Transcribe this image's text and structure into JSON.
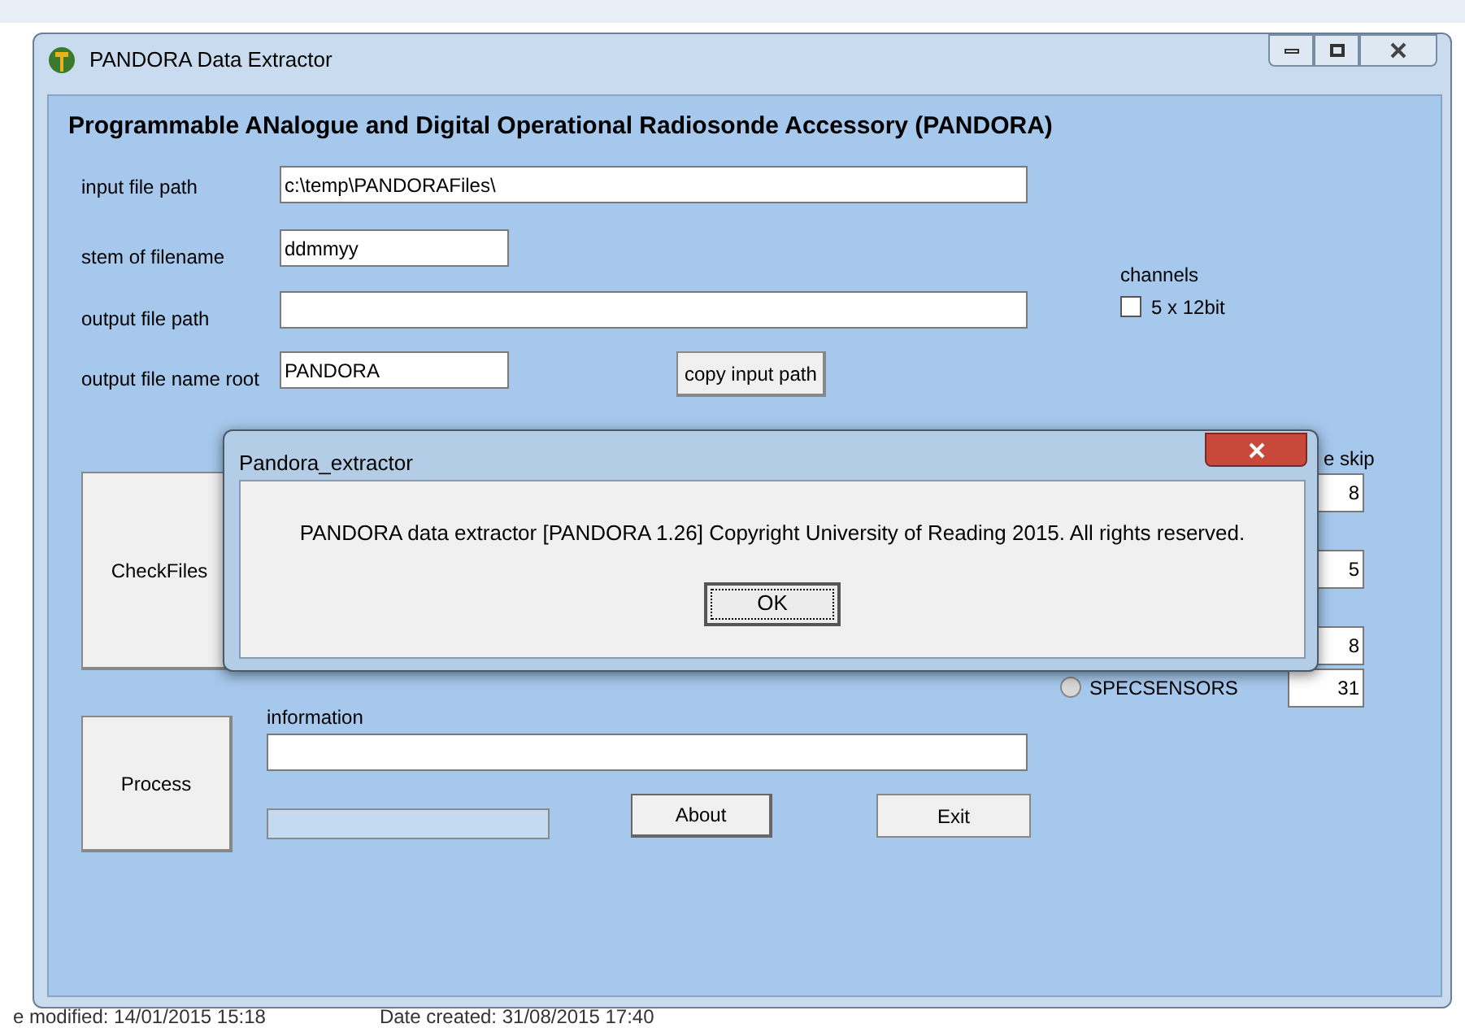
{
  "window": {
    "title": "PANDORA Data Extractor"
  },
  "header": "Programmable ANalogue and Digital Operational Radiosonde Accessory (PANDORA)",
  "fields": [
    {
      "label": "input file path",
      "value": "c:\\temp\\PANDORAFiles\\",
      "wide": true
    },
    {
      "label": "stem of filename",
      "value": "ddmmyy",
      "wide": false
    },
    {
      "label": "output file path",
      "wide": true
    },
    {
      "label": "output file name root",
      "value": "PANDORA",
      "wide": false
    }
  ],
  "copy_button": "copy input path",
  "channels": {
    "label": "channels",
    "option": {
      "label": "5 x 12bit",
      "checked": false
    }
  },
  "skip": {
    "label": "e skip",
    "values": [
      "8",
      "5",
      "8",
      "31"
    ]
  },
  "sensor_option": {
    "label": "SPECSENSORS",
    "selected": false
  },
  "checkfiles_button": "CheckFiles",
  "process_button": "Process",
  "information": {
    "label": "information"
  },
  "progress": {
    "level": 0
  },
  "about_button": "About",
  "exit_button": "Exit",
  "dialog": {
    "title": "Pandora_extractor",
    "message": "PANDORA data extractor [PANDORA 1.26] Copyright University of Reading 2015. All rights reserved.",
    "button": "OK"
  },
  "status_bar": [
    "e modified: 14/01/2015 15:18",
    "Date created: 31/08/2015 17:40"
  ]
}
